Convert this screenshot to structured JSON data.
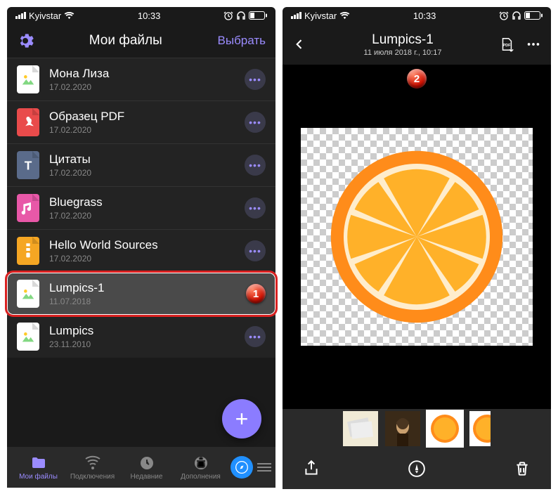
{
  "status": {
    "carrier": "Kyivstar",
    "time": "10:33"
  },
  "left": {
    "title": "Мои файлы",
    "select": "Выбрать",
    "files": [
      {
        "name": "Мона Лиза",
        "date": "17.02.2020",
        "icon": "img"
      },
      {
        "name": "Образец PDF",
        "date": "17.02.2020",
        "icon": "pdf"
      },
      {
        "name": "Цитаты",
        "date": "17.02.2020",
        "icon": "txt"
      },
      {
        "name": "Bluegrass",
        "date": "17.02.2020",
        "icon": "mus"
      },
      {
        "name": "Hello World Sources",
        "date": "17.02.2020",
        "icon": "zip"
      },
      {
        "name": "Lumpics-1",
        "date": "11.07.2018",
        "icon": "img"
      },
      {
        "name": "Lumpics",
        "date": "23.11.2010",
        "icon": "img"
      }
    ],
    "nav": [
      {
        "label": "Мои файлы"
      },
      {
        "label": "Подключения"
      },
      {
        "label": "Недавние"
      },
      {
        "label": "Дополнения"
      }
    ],
    "badge1": "1"
  },
  "right": {
    "title": "Lumpics-1",
    "subtitle": "11 июля 2018 г., 10:17",
    "badge2": "2"
  }
}
